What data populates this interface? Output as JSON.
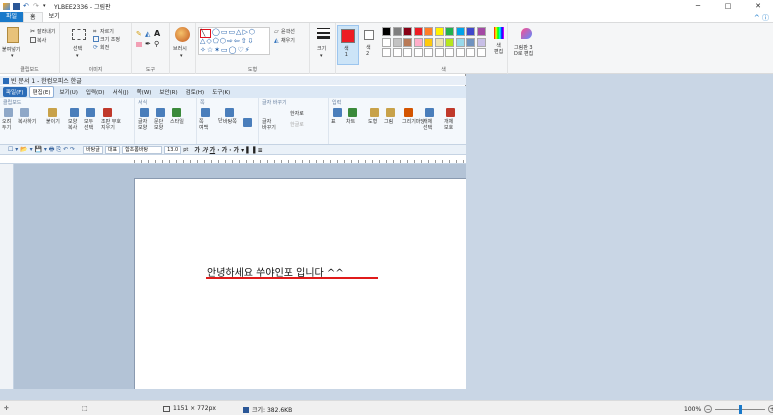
{
  "window": {
    "title": "YLBEE2336 - 그림판",
    "controls": {
      "minimize": "─",
      "maximize": "□",
      "close": "✕"
    }
  },
  "tabs": [
    {
      "label": "파일"
    },
    {
      "label": "홈"
    },
    {
      "label": "보기"
    }
  ],
  "ribbon": {
    "clipboard": {
      "paste": "붙여넣기",
      "cut": "잘라내기",
      "copy": "복사",
      "label": "클립보드"
    },
    "image": {
      "select": "선택",
      "crop": "자르기",
      "resize": "크기 조정",
      "rotate": "회전",
      "label": "이미지"
    },
    "tools": {
      "label": "도구"
    },
    "brushes": {
      "label": "브러시"
    },
    "shapes": {
      "outline": "윤곽선",
      "fill": "채우기",
      "label": "도형"
    },
    "size": {
      "label": "크기"
    },
    "color1": {
      "label": "색\n1"
    },
    "color2": {
      "label": "색\n2"
    },
    "colors": {
      "edit": "색\n편집",
      "label": "색",
      "swatches": [
        "#000000",
        "#7f7f7f",
        "#880015",
        "#ed1c24",
        "#ff7f27",
        "#fff200",
        "#22b14c",
        "#00a2e8",
        "#3f48cc",
        "#a349a4",
        "#ffffff",
        "#c3c3c3",
        "#b97a57",
        "#ffaec9",
        "#ffc90e",
        "#efe4b0",
        "#b5e61d",
        "#99d9ea",
        "#7092be",
        "#c8bfe7"
      ]
    },
    "paint3d": {
      "label": "그림판 3\nD로 편집"
    }
  },
  "hwp": {
    "title": "빈 문서 1 - 한컴오피스 한글",
    "menu": [
      "파일(F)",
      "편집(E)",
      "보기(U)",
      "입력(D)",
      "서식(J)",
      "쪽(W)",
      "보안(R)",
      "검토(H)",
      "도구(K)"
    ],
    "groups": {
      "clipboard": "클립보드",
      "format": "서식",
      "page": "쪽",
      "text": "글자 바꾸기",
      "input": "입력"
    },
    "buttons": [
      "오려\n두기",
      "복사하기",
      "붙이기",
      "모양\n복사",
      "모두\n선택",
      "조판 부호\n지우기",
      "글자\n모양",
      "문단\n모양",
      "스타일",
      "쪽\n여백",
      "바탕쪽",
      "단",
      "글자\n바꾸기",
      "한자로",
      "한글로",
      "표",
      "차트",
      "도형",
      "그림",
      "그리기마당",
      "개체\n선택",
      "개체\n보호"
    ],
    "format_bar": {
      "style": "바탕글",
      "font_lang": "대표",
      "font": "함초롬바탕",
      "size": "13.0",
      "unit": "pt"
    },
    "doc_text": "안녕하세요 쑤야인포 입니다 ^^"
  },
  "status": {
    "dimensions": "1151 × 772px",
    "filesize": "크기: 382.6KB",
    "zoom": "100%",
    "zoom_out": "−",
    "zoom_in": "+"
  }
}
